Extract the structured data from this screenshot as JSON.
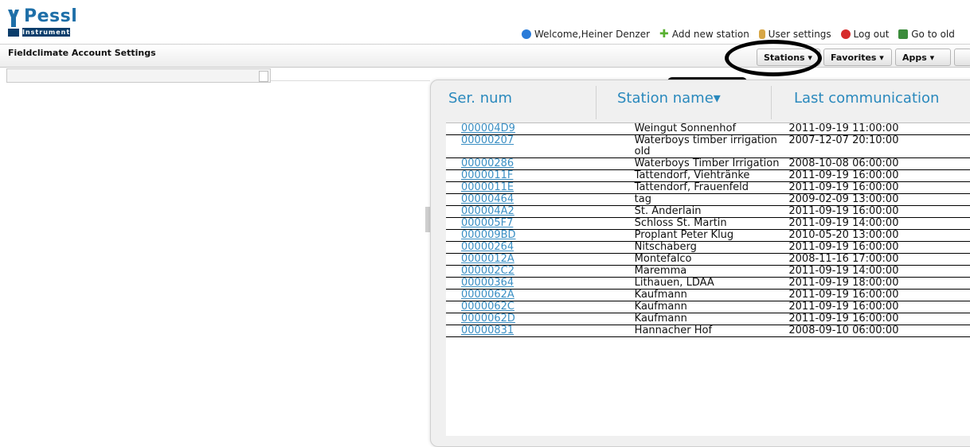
{
  "header": {
    "logo_text": "Pessl",
    "logo_sub": "Instruments",
    "page_title": "Fieldclimate Account Settings"
  },
  "topnav": {
    "welcome": "Welcome,Heiner Denzer",
    "add_station": "Add new station",
    "user_settings": "User settings",
    "logout": "Log out",
    "go_old": "Go to old"
  },
  "menu": {
    "stations": "Stations ▾",
    "favorites": "Favorites ▾",
    "apps": "Apps ▾"
  },
  "table": {
    "columns": [
      "Ser. num",
      "Station name▾",
      "Last communication"
    ],
    "rows": [
      {
        "ser": "000004D9",
        "name": "Weingut Sonnenhof",
        "last": "2011-09-19 11:00:00"
      },
      {
        "ser": "00000207",
        "name": "Waterboys timber irrigation old",
        "last": "2007-12-07 20:10:00"
      },
      {
        "ser": "00000286",
        "name": "Waterboys Timber Irrigation",
        "last": "2008-10-08 06:00:00"
      },
      {
        "ser": "0000011F",
        "name": "Tattendorf, Viehtränke",
        "last": "2011-09-19 16:00:00"
      },
      {
        "ser": "0000011E",
        "name": "Tattendorf, Frauenfeld",
        "last": "2011-09-19 16:00:00"
      },
      {
        "ser": "00000464",
        "name": "tag",
        "last": "2009-02-09 13:00:00"
      },
      {
        "ser": "000004A2",
        "name": "St. Anderlain",
        "last": "2011-09-19 16:00:00"
      },
      {
        "ser": "000005F7",
        "name": "Schloss St. Martin",
        "last": "2011-09-19 14:00:00"
      },
      {
        "ser": "000009BD",
        "name": "Proplant Peter Klug",
        "last": "2010-05-20 13:00:00"
      },
      {
        "ser": "00000264",
        "name": "Nitschaberg",
        "last": "2011-09-19 16:00:00"
      },
      {
        "ser": "0000012A",
        "name": "Montefalco",
        "last": "2008-11-16 17:00:00"
      },
      {
        "ser": "000002C2",
        "name": "Maremma",
        "last": "2011-09-19 14:00:00"
      },
      {
        "ser": "00000364",
        "name": "Lithauen, LDAA",
        "last": "2011-09-19 18:00:00"
      },
      {
        "ser": "0000062A",
        "name": "Kaufmann",
        "last": "2011-09-19 16:00:00"
      },
      {
        "ser": "0000062C",
        "name": "Kaufmann",
        "last": "2011-09-19 16:00:00"
      },
      {
        "ser": "0000062D",
        "name": "Kaufmann",
        "last": "2011-09-19 16:00:00"
      },
      {
        "ser": "00000831",
        "name": "Hannacher Hof",
        "last": "2008-09-10 06:00:00"
      }
    ]
  },
  "colors": {
    "link": "#3a8fc4",
    "header_text": "#2a89bd",
    "annotation": "#000000"
  }
}
